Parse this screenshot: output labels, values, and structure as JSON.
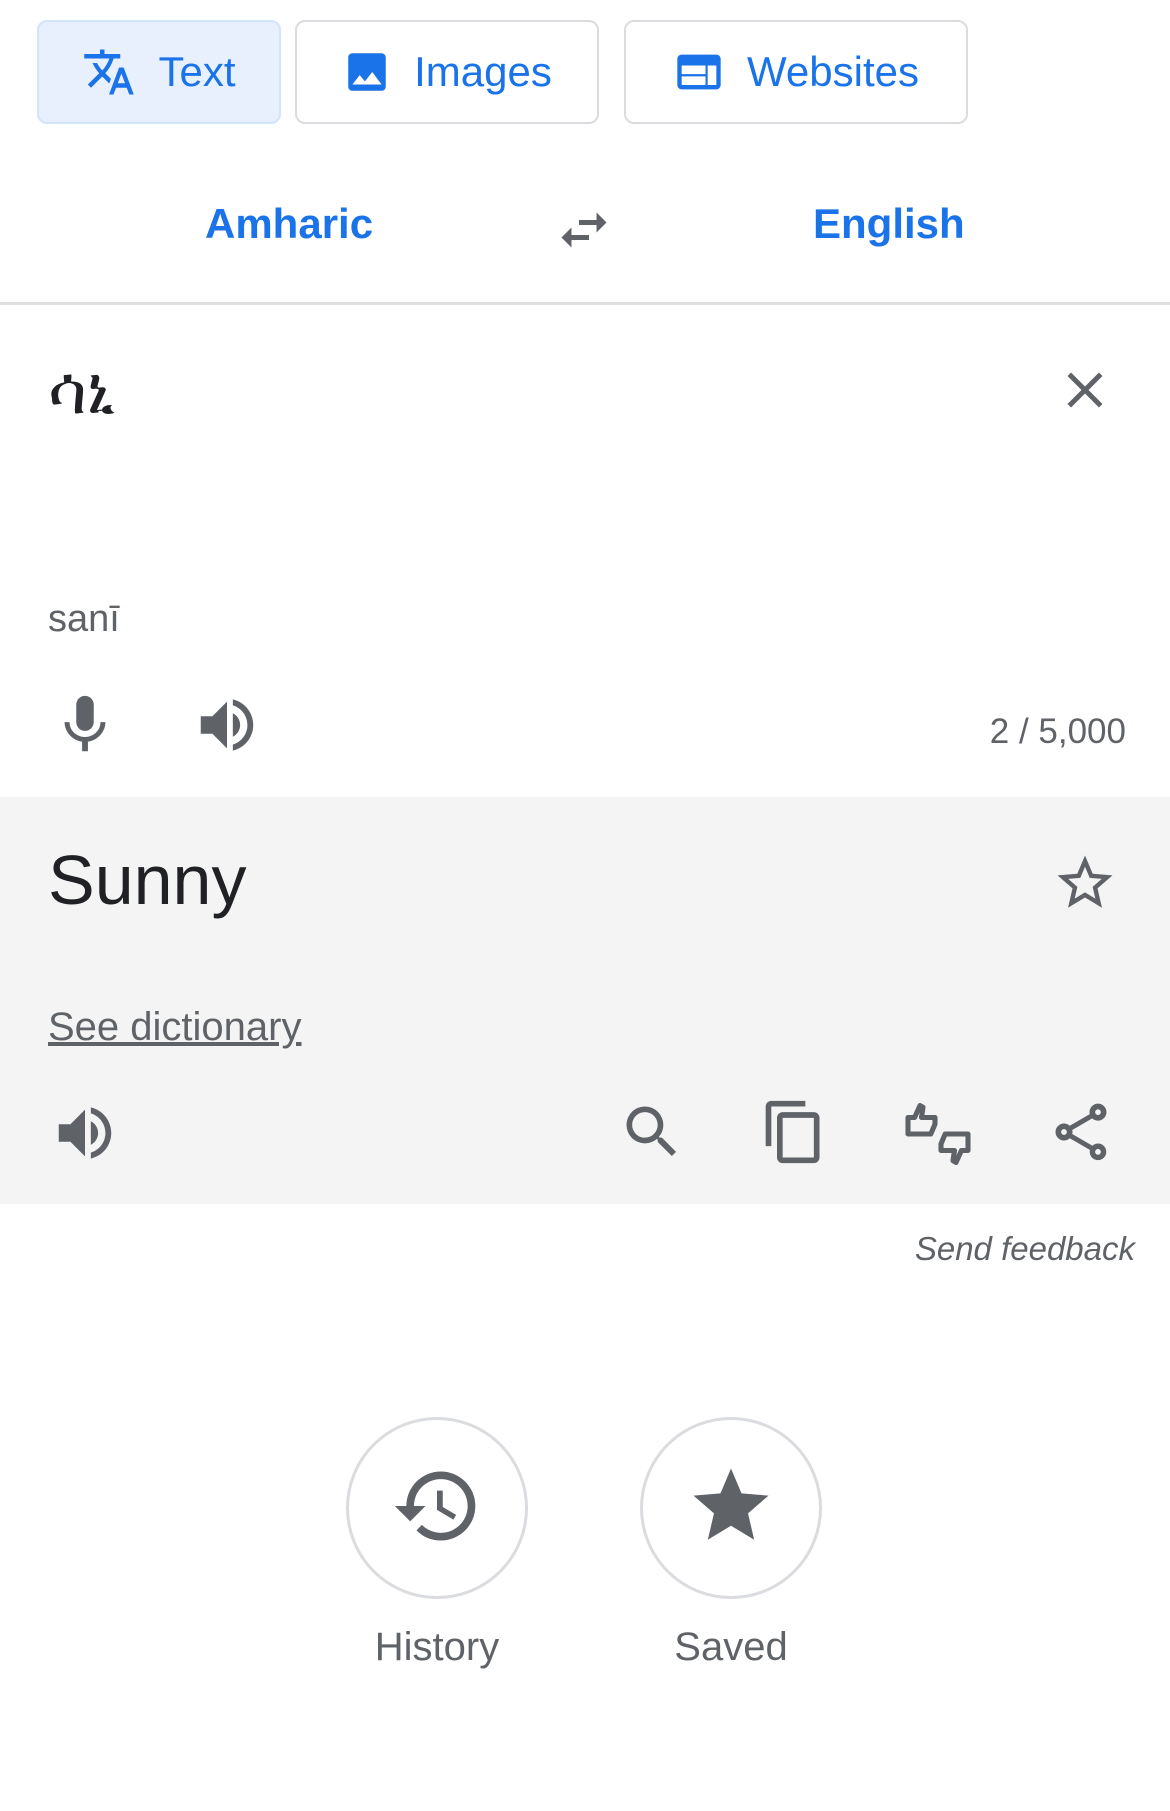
{
  "modes": [
    {
      "label": "Text",
      "icon": "translate-icon",
      "active": true
    },
    {
      "label": "Images",
      "icon": "image-icon",
      "active": false
    },
    {
      "label": "Websites",
      "icon": "web-icon",
      "active": false
    }
  ],
  "languages": {
    "source": "Amharic",
    "target": "English",
    "swap_icon": "swap-icon"
  },
  "input": {
    "text": "ሳኒ",
    "transliteration": "sanī",
    "char_count": "2 / 5,000"
  },
  "output": {
    "text": "Sunny",
    "dictionary_link": "See dictionary"
  },
  "feedback": "Send feedback",
  "bottom": {
    "history_label": "History",
    "saved_label": "Saved"
  },
  "colors": {
    "accent": "#1a73e8",
    "icon_gray": "#5f6368",
    "output_bg": "#f4f4f4"
  }
}
